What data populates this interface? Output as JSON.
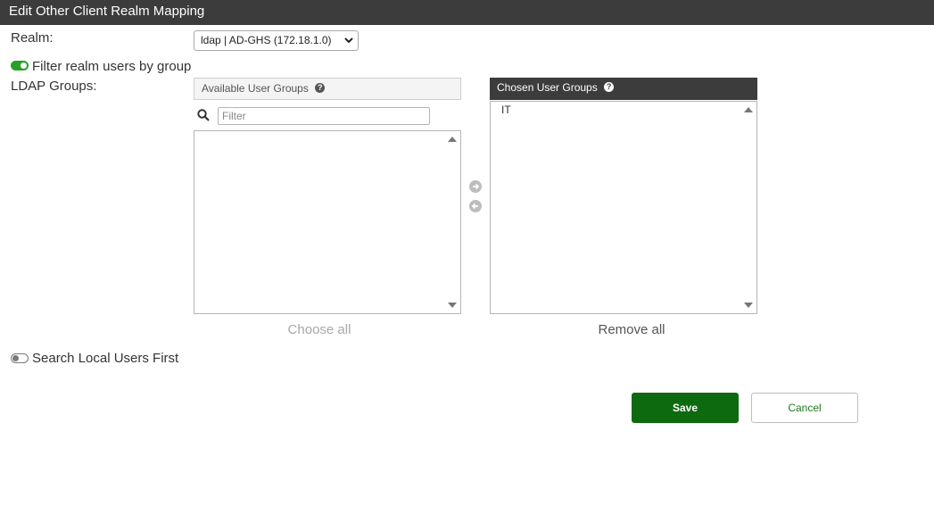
{
  "window": {
    "title": "Edit Other Client Realm Mapping"
  },
  "form": {
    "realm_label": "Realm:",
    "realm_value": "ldap | AD-GHS (172.18.1.0)",
    "filter_toggle_label": "Filter realm users by group",
    "filter_toggle_on": true,
    "ldap_groups_label": "LDAP Groups:",
    "search_local_label": "Search Local Users First",
    "search_local_on": false
  },
  "available": {
    "header": "Available User Groups",
    "filter_placeholder": "Filter",
    "items": [],
    "choose_all": "Choose all"
  },
  "chosen": {
    "header": "Chosen User Groups",
    "items": [
      "IT"
    ],
    "remove_all": "Remove all"
  },
  "buttons": {
    "save": "Save",
    "cancel": "Cancel"
  },
  "colors": {
    "accent": "#0e6a0e",
    "toggle_on": "#2aa02a",
    "header_dark": "#3c3c3c"
  }
}
